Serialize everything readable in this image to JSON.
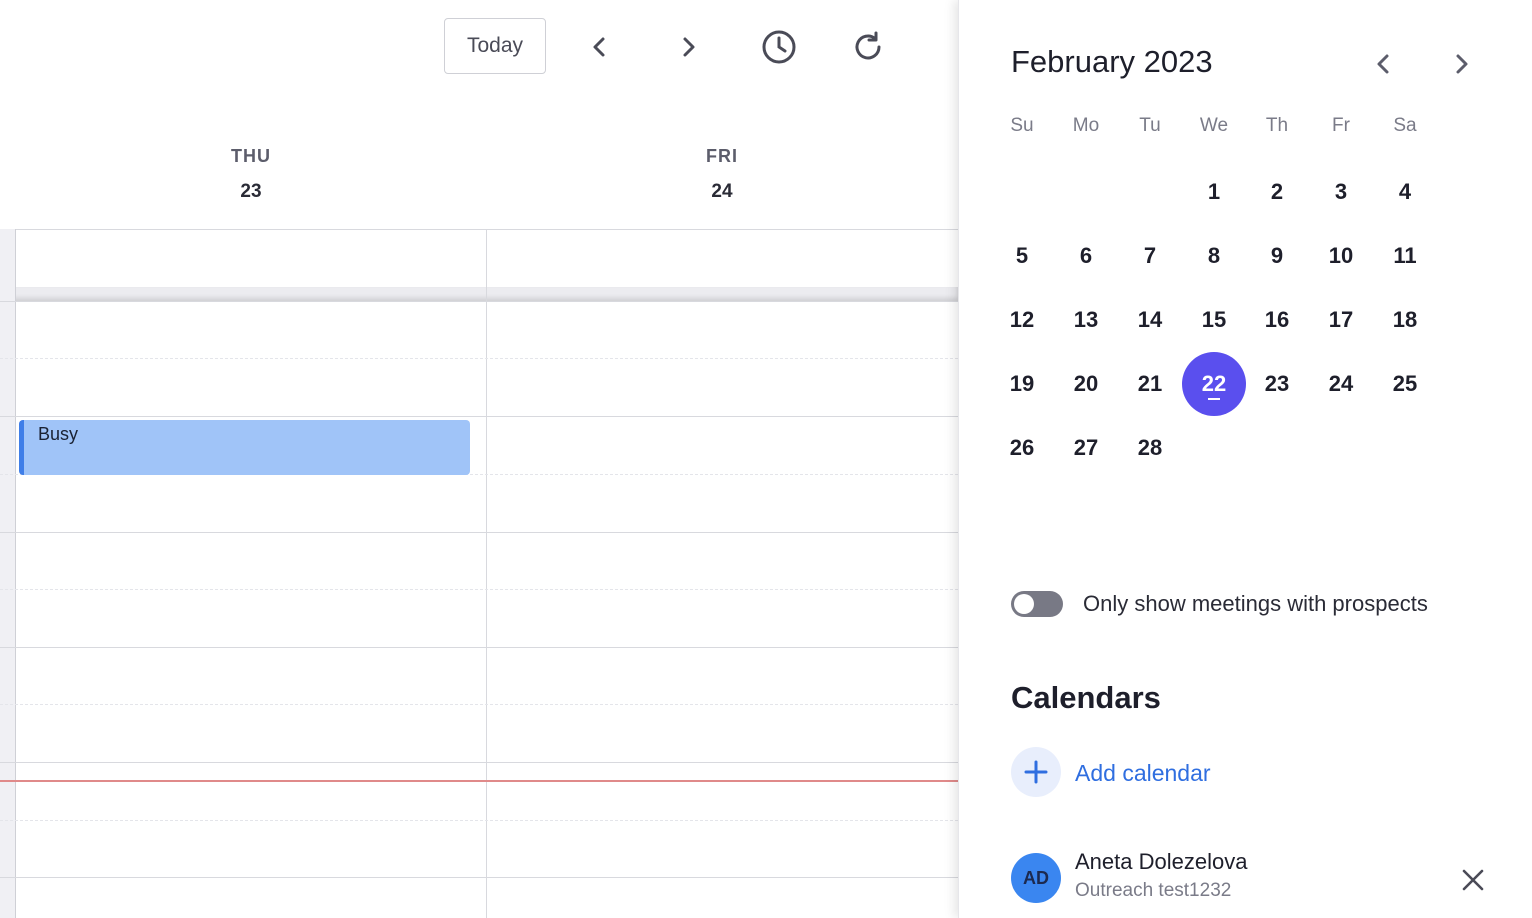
{
  "toolbar": {
    "today_label": "Today",
    "icons": [
      "chevron-left-icon",
      "chevron-right-icon",
      "clock-icon",
      "refresh-icon"
    ]
  },
  "days": [
    {
      "name": "THU",
      "num": "23"
    },
    {
      "name": "FRI",
      "num": "24"
    }
  ],
  "event": {
    "title": "Busy",
    "color": "#a0c4f8",
    "accent": "#3f7ee8"
  },
  "mini_calendar": {
    "title": "February 2023",
    "weekdays": [
      "Su",
      "Mo",
      "Tu",
      "We",
      "Th",
      "Fr",
      "Sa"
    ],
    "weeks": [
      [
        "",
        "",
        "",
        "1",
        "2",
        "3",
        "4"
      ],
      [
        "5",
        "6",
        "7",
        "8",
        "9",
        "10",
        "11"
      ],
      [
        "12",
        "13",
        "14",
        "15",
        "16",
        "17",
        "18"
      ],
      [
        "19",
        "20",
        "21",
        "22",
        "23",
        "24",
        "25"
      ],
      [
        "26",
        "27",
        "28",
        "",
        "",
        "",
        ""
      ]
    ],
    "selected": "22",
    "selected_color": "#5a4fee"
  },
  "filter": {
    "label": "Only show meetings with prospects",
    "enabled": false
  },
  "calendars": {
    "heading": "Calendars",
    "add_label": "Add calendar",
    "items": [
      {
        "initials": "AD",
        "name": "Aneta Dolezelova",
        "subtitle": "Outreach test1232"
      }
    ]
  }
}
